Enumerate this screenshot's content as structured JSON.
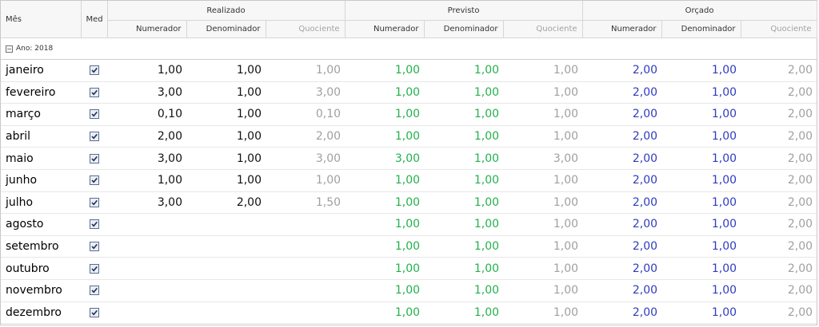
{
  "header": {
    "mes": "Mês",
    "med": "Med",
    "groups": [
      "Realizado",
      "Previsto",
      "Orçado"
    ],
    "sub": [
      "Numerador",
      "Denominador",
      "Quociente"
    ]
  },
  "group_row": {
    "expander": "−",
    "label": "Ano: 2018"
  },
  "colors": {
    "realizado": "#111111",
    "quociente": "#a0a0a0",
    "previsto": "#22b14c",
    "orcado": "#2f3bbf"
  },
  "rows": [
    {
      "mes": "janeiro",
      "r_num": "1,00",
      "r_den": "1,00",
      "r_quo": "1,00",
      "p_num": "1,00",
      "p_den": "1,00",
      "p_quo": "1,00",
      "o_num": "2,00",
      "o_den": "1,00",
      "o_quo": "2,00"
    },
    {
      "mes": "fevereiro",
      "r_num": "3,00",
      "r_den": "1,00",
      "r_quo": "3,00",
      "p_num": "1,00",
      "p_den": "1,00",
      "p_quo": "1,00",
      "o_num": "2,00",
      "o_den": "1,00",
      "o_quo": "2,00"
    },
    {
      "mes": "março",
      "r_num": "0,10",
      "r_den": "1,00",
      "r_quo": "0,10",
      "p_num": "1,00",
      "p_den": "1,00",
      "p_quo": "1,00",
      "o_num": "2,00",
      "o_den": "1,00",
      "o_quo": "2,00"
    },
    {
      "mes": "abril",
      "r_num": "2,00",
      "r_den": "1,00",
      "r_quo": "2,00",
      "p_num": "1,00",
      "p_den": "1,00",
      "p_quo": "1,00",
      "o_num": "2,00",
      "o_den": "1,00",
      "o_quo": "2,00"
    },
    {
      "mes": "maio",
      "r_num": "3,00",
      "r_den": "1,00",
      "r_quo": "3,00",
      "p_num": "3,00",
      "p_den": "1,00",
      "p_quo": "3,00",
      "o_num": "2,00",
      "o_den": "1,00",
      "o_quo": "2,00"
    },
    {
      "mes": "junho",
      "r_num": "1,00",
      "r_den": "1,00",
      "r_quo": "1,00",
      "p_num": "1,00",
      "p_den": "1,00",
      "p_quo": "1,00",
      "o_num": "2,00",
      "o_den": "1,00",
      "o_quo": "2,00"
    },
    {
      "mes": "julho",
      "r_num": "3,00",
      "r_den": "2,00",
      "r_quo": "1,50",
      "p_num": "1,00",
      "p_den": "1,00",
      "p_quo": "1,00",
      "o_num": "2,00",
      "o_den": "1,00",
      "o_quo": "2,00"
    },
    {
      "mes": "agosto",
      "r_num": "",
      "r_den": "",
      "r_quo": "",
      "p_num": "1,00",
      "p_den": "1,00",
      "p_quo": "1,00",
      "o_num": "2,00",
      "o_den": "1,00",
      "o_quo": "2,00"
    },
    {
      "mes": "setembro",
      "r_num": "",
      "r_den": "",
      "r_quo": "",
      "p_num": "1,00",
      "p_den": "1,00",
      "p_quo": "1,00",
      "o_num": "2,00",
      "o_den": "1,00",
      "o_quo": "2,00"
    },
    {
      "mes": "outubro",
      "r_num": "",
      "r_den": "",
      "r_quo": "",
      "p_num": "1,00",
      "p_den": "1,00",
      "p_quo": "1,00",
      "o_num": "2,00",
      "o_den": "1,00",
      "o_quo": "2,00"
    },
    {
      "mes": "novembro",
      "r_num": "",
      "r_den": "",
      "r_quo": "",
      "p_num": "1,00",
      "p_den": "1,00",
      "p_quo": "1,00",
      "o_num": "2,00",
      "o_den": "1,00",
      "o_quo": "2,00"
    },
    {
      "mes": "dezembro",
      "r_num": "",
      "r_den": "",
      "r_quo": "",
      "p_num": "1,00",
      "p_den": "1,00",
      "p_quo": "1,00",
      "o_num": "2,00",
      "o_den": "1,00",
      "o_quo": "2,00"
    }
  ]
}
